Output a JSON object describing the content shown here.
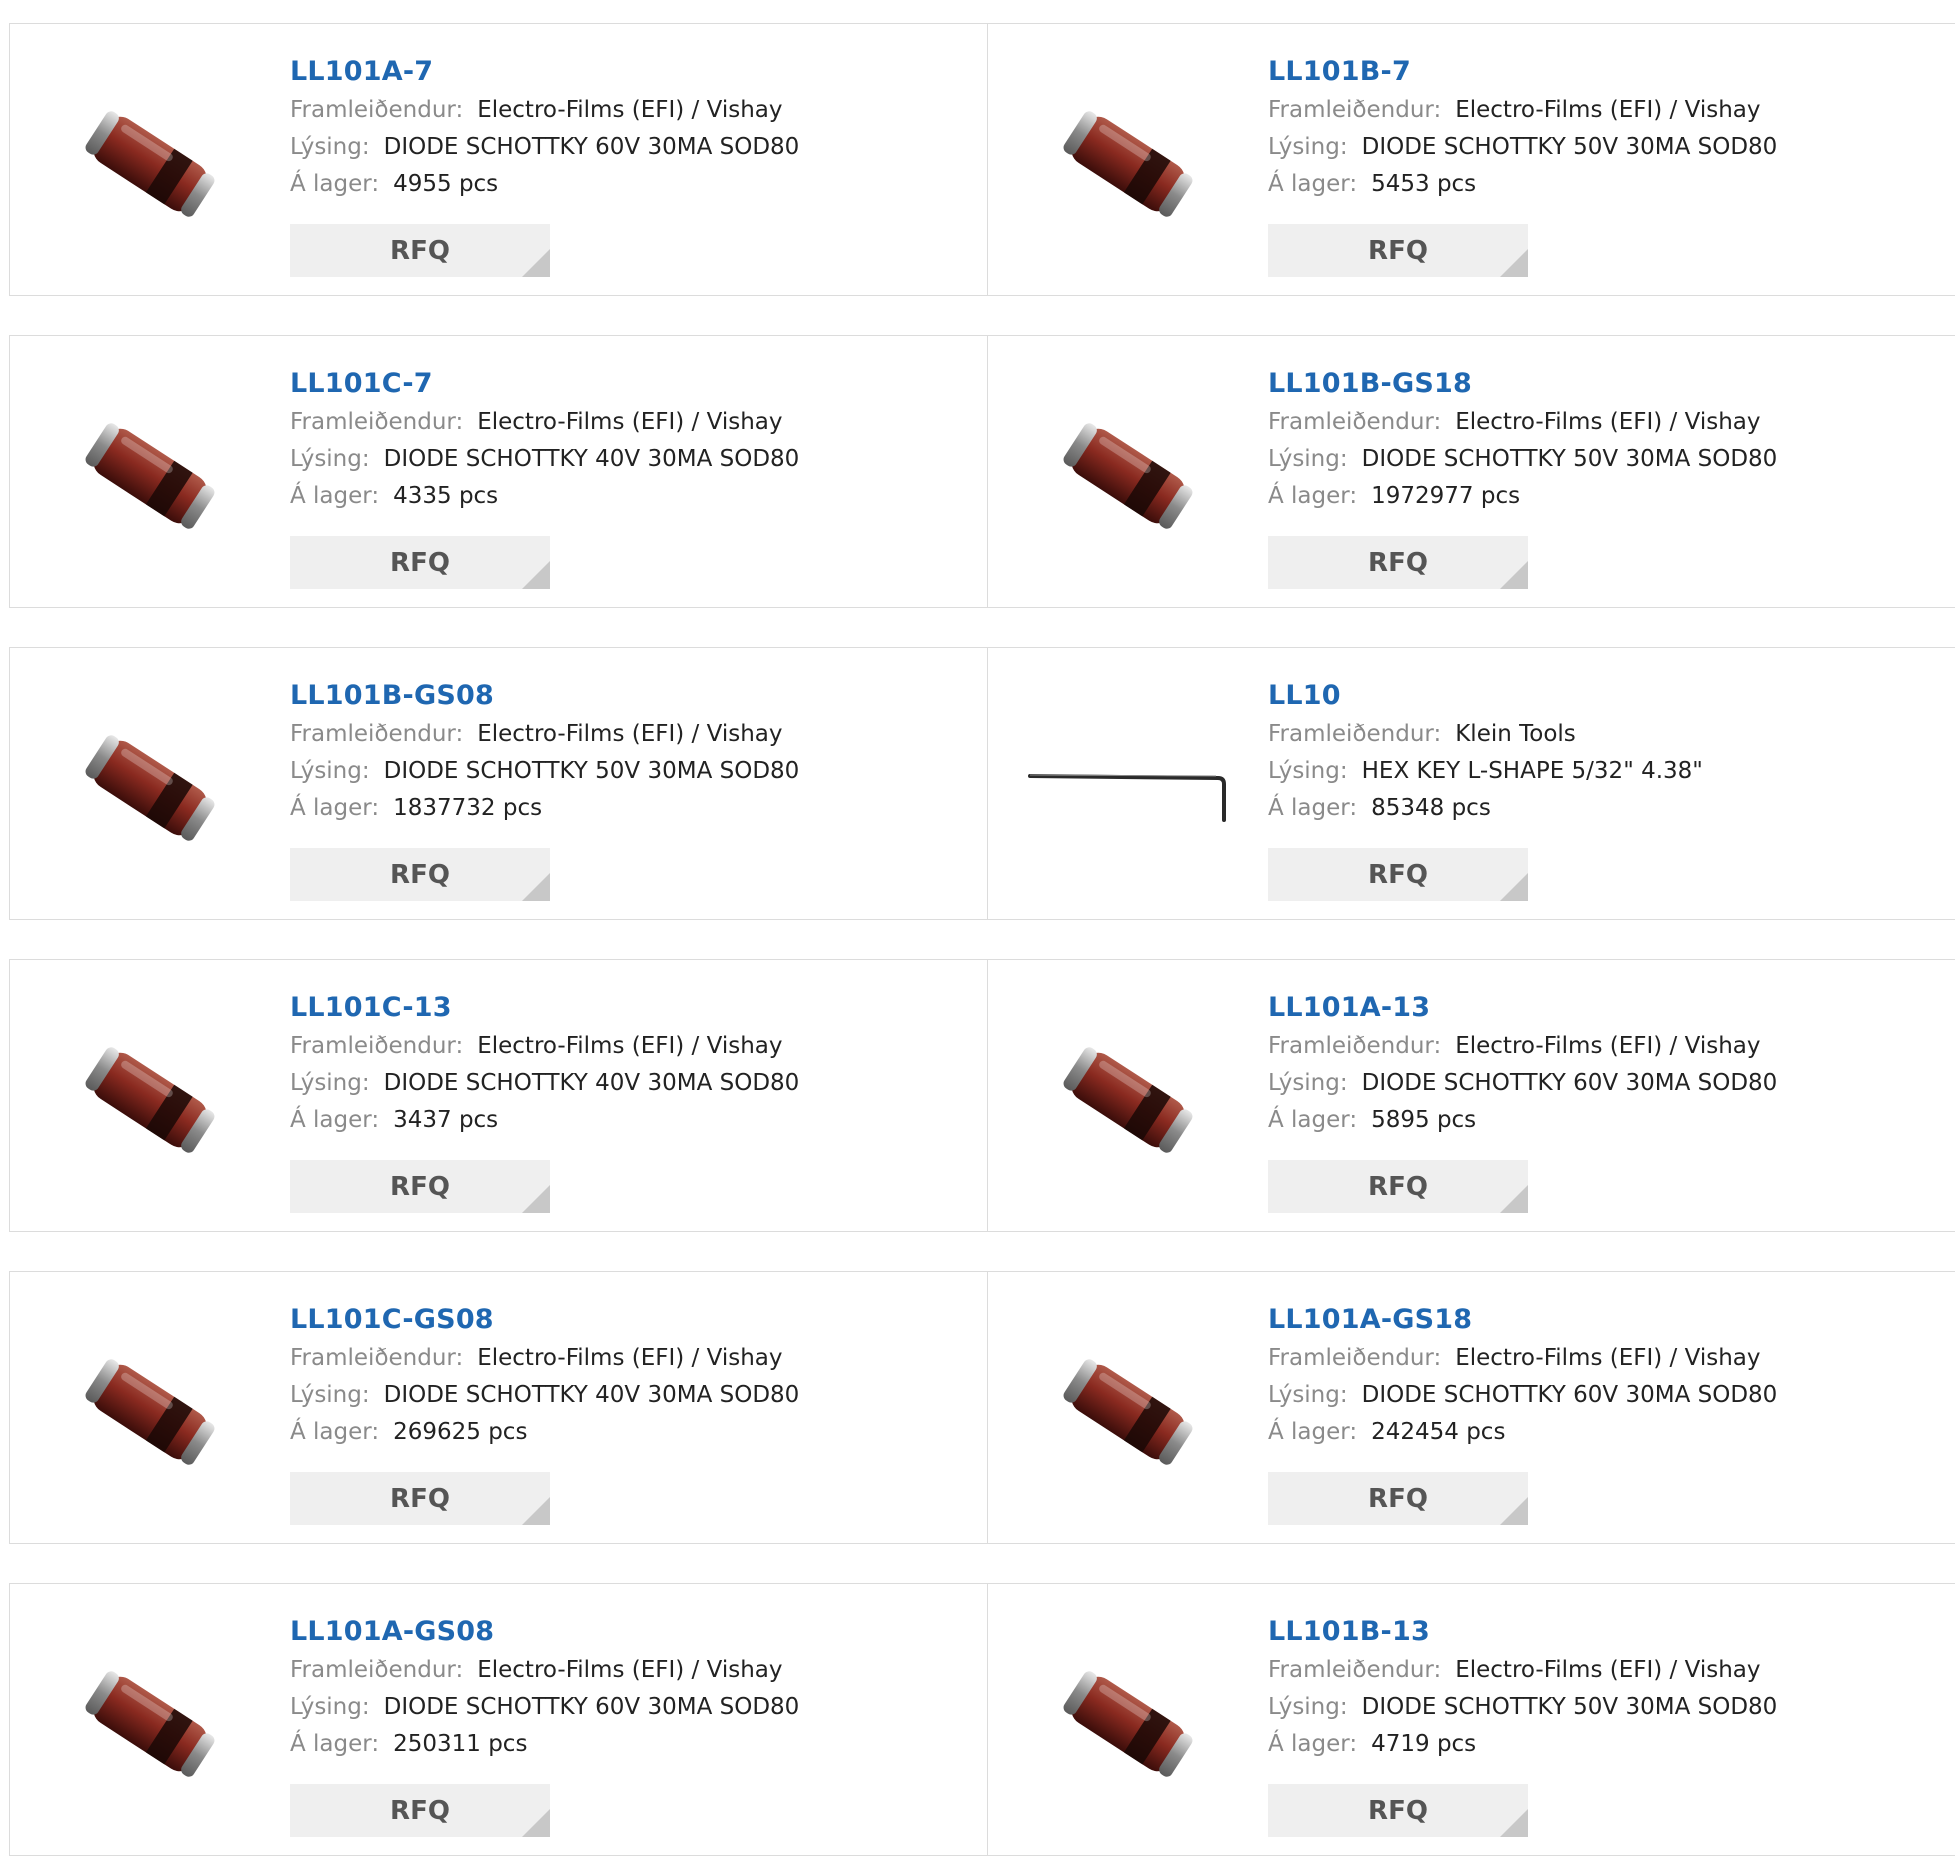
{
  "labels": {
    "manufacturer": "Framleiðendur:",
    "description": "Lýsing:",
    "stock": "Á lager:",
    "rfq": "RFQ"
  },
  "products": [
    {
      "part": "LL101A-7",
      "manufacturer": "Electro-Films (EFI) / Vishay",
      "description": "DIODE SCHOTTKY 60V 30MA SOD80",
      "stock": "4955 pcs",
      "image": "diode-image"
    },
    {
      "part": "LL101B-7",
      "manufacturer": "Electro-Films (EFI) / Vishay",
      "description": "DIODE SCHOTTKY 50V 30MA SOD80",
      "stock": "5453 pcs",
      "image": "diode-image"
    },
    {
      "part": "LL101C-7",
      "manufacturer": "Electro-Films (EFI) / Vishay",
      "description": "DIODE SCHOTTKY 40V 30MA SOD80",
      "stock": "4335 pcs",
      "image": "diode-image"
    },
    {
      "part": "LL101B-GS18",
      "manufacturer": "Electro-Films (EFI) / Vishay",
      "description": "DIODE SCHOTTKY 50V 30MA SOD80",
      "stock": "1972977 pcs",
      "image": "diode-image"
    },
    {
      "part": "LL101B-GS08",
      "manufacturer": "Electro-Films (EFI) / Vishay",
      "description": "DIODE SCHOTTKY 50V 30MA SOD80",
      "stock": "1837732 pcs",
      "image": "diode-image"
    },
    {
      "part": "LL10",
      "manufacturer": "Klein Tools",
      "description": "HEX KEY L-SHAPE 5/32\" 4.38\"",
      "stock": "85348 pcs",
      "image": "hex-key-image"
    },
    {
      "part": "LL101C-13",
      "manufacturer": "Electro-Films (EFI) / Vishay",
      "description": "DIODE SCHOTTKY 40V 30MA SOD80",
      "stock": "3437 pcs",
      "image": "diode-image"
    },
    {
      "part": "LL101A-13",
      "manufacturer": "Electro-Films (EFI) / Vishay",
      "description": "DIODE SCHOTTKY 60V 30MA SOD80",
      "stock": "5895 pcs",
      "image": "diode-image"
    },
    {
      "part": "LL101C-GS08",
      "manufacturer": "Electro-Films (EFI) / Vishay",
      "description": "DIODE SCHOTTKY 40V 30MA SOD80",
      "stock": "269625 pcs",
      "image": "diode-image"
    },
    {
      "part": "LL101A-GS18",
      "manufacturer": "Electro-Films (EFI) / Vishay",
      "description": "DIODE SCHOTTKY 60V 30MA SOD80",
      "stock": "242454 pcs",
      "image": "diode-image"
    },
    {
      "part": "LL101A-GS08",
      "manufacturer": "Electro-Films (EFI) / Vishay",
      "description": "DIODE SCHOTTKY 60V 30MA SOD80",
      "stock": "250311 pcs",
      "image": "diode-image"
    },
    {
      "part": "LL101B-13",
      "manufacturer": "Electro-Films (EFI) / Vishay",
      "description": "DIODE SCHOTTKY 50V 30MA SOD80",
      "stock": "4719 pcs",
      "image": "diode-image"
    }
  ],
  "colors": {
    "link": "#1f67b1",
    "label": "#8a8a8a",
    "text": "#222222",
    "button_bg": "#efefef"
  }
}
